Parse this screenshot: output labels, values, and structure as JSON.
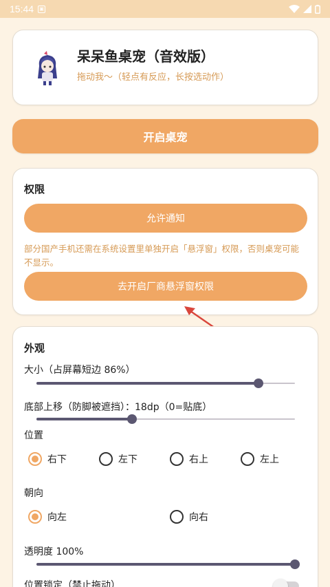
{
  "status_bar": {
    "time": "15:44",
    "notification_icon": "image-notification-icon",
    "icons": [
      "wifi-icon",
      "signal-icon",
      "battery-icon"
    ]
  },
  "header": {
    "title": "呆呆鱼桌宠（音效版）",
    "subtitle": "拖动我～（轻点有反应，长按选动作）"
  },
  "start_button": "开启桌宠",
  "permissions": {
    "title": "权限",
    "allow_notify_button": "允许通知",
    "note": "部分国产手机还需在系统设置里单独开启「悬浮窗」权限，否则桌宠可能不显示。",
    "overlay_button": "去开启厂商悬浮窗权限"
  },
  "appearance": {
    "title": "外观",
    "size_label": "大小（占屏幕短边 86%）",
    "size_value": 0.86,
    "offset_label": "底部上移（防脚被遮挡）：18dp（0=贴底）",
    "offset_fraction": 0.37,
    "position_label": "位置",
    "position_options": [
      "右下",
      "左下",
      "右上",
      "左上"
    ],
    "position_selected": "右下",
    "direction_label": "朝向",
    "direction_options": [
      "向左",
      "向右"
    ],
    "direction_selected": "向左",
    "opacity_label": "透明度 100%",
    "opacity_value": 1.0,
    "lock_label": "位置锁定（禁止拖动）",
    "lock_enabled": false
  },
  "colors": {
    "accent": "#f0a764",
    "accent_text": "#d69a55",
    "background": "#fdf3e4",
    "slider": "#5b5771",
    "annotation_arrow": "#d9463c"
  }
}
